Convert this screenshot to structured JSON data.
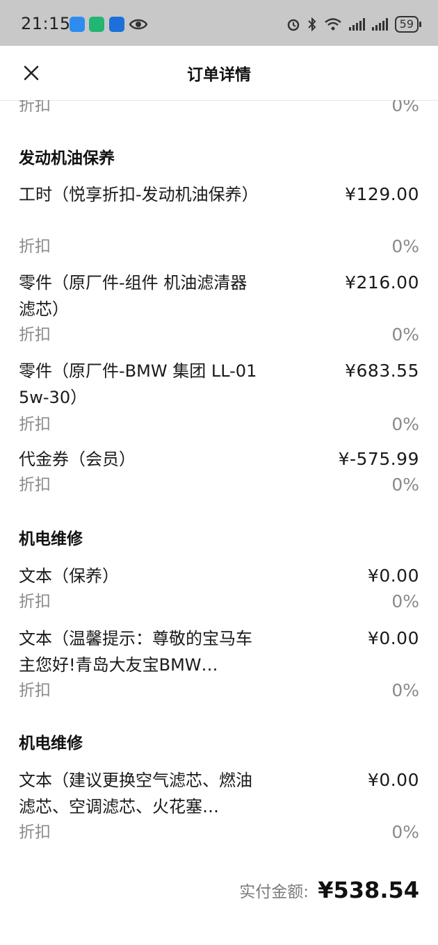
{
  "status_bar": {
    "time": "21:15",
    "battery": "59"
  },
  "header": {
    "title": "订单详情"
  },
  "top_partial": {
    "discount_label": "折扣",
    "discount_value": "0%"
  },
  "sections": [
    {
      "title": "发动机油保养",
      "items": [
        {
          "name": "工时（悦享折扣-发动机油保养）",
          "price": "¥129.00",
          "discount_label": "折扣",
          "discount_value": "0%"
        },
        {
          "name": "零件（原厂件-组件 机油滤清器滤芯）",
          "price": "¥216.00",
          "discount_label": "折扣",
          "discount_value": "0%"
        },
        {
          "name": "零件（原厂件-BMW 集团 LL-01 5w-30）",
          "price": "¥683.55",
          "discount_label": "折扣",
          "discount_value": "0%"
        },
        {
          "name": "代金券（会员）",
          "price": "¥-575.99",
          "discount_label": "折扣",
          "discount_value": "0%"
        }
      ]
    },
    {
      "title": "机电维修",
      "items": [
        {
          "name": "文本（保养）",
          "price": "¥0.00",
          "discount_label": "折扣",
          "discount_value": "0%"
        },
        {
          "name": "文本（温馨提示：尊敬的宝马车主您好!青岛大友宝BMW…",
          "price": "¥0.00",
          "discount_label": "折扣",
          "discount_value": "0%"
        }
      ]
    },
    {
      "title": "机电维修",
      "items": [
        {
          "name": "文本（建议更换空气滤芯、燃油滤芯、空调滤芯、火花塞…",
          "price": "¥0.00",
          "discount_label": "折扣",
          "discount_value": "0%"
        }
      ]
    }
  ],
  "total": {
    "label": "实付金额:",
    "value": "¥538.54"
  },
  "icons": {
    "close": "close-icon",
    "status": [
      "message-app-icon",
      "mi-app-icon",
      "autohome-app-icon",
      "eye-icon",
      "alarm-icon",
      "bluetooth-icon",
      "wifi-icon",
      "signal-icon",
      "signal-icon"
    ]
  }
}
